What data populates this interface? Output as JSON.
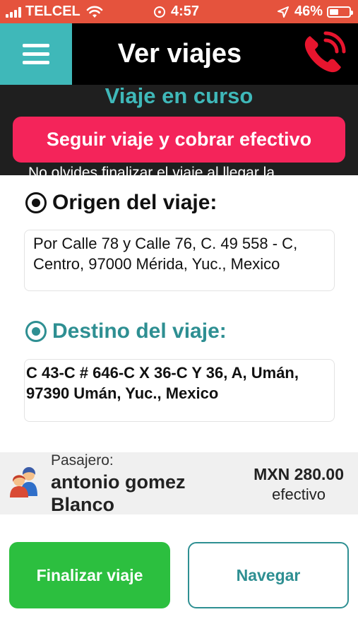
{
  "status_bar": {
    "carrier": "TELCEL",
    "time": "4:57",
    "battery_percent": "46%",
    "battery_level": 0.46,
    "background_color": "#e5533d"
  },
  "header": {
    "title": "Ver viajes",
    "menu_icon": "hamburger-menu-icon",
    "call_icon": "phone-call-icon",
    "menu_color": "#3fb8b9",
    "call_color": "#e8152e"
  },
  "trip_banner": {
    "title": "Viaje en curso",
    "follow_button_label": "Seguir viaje y cobrar efectivo",
    "note": "No olvides finalizar el viaje al llegar la",
    "button_color": "#f4245a"
  },
  "origin": {
    "label": "Origen del viaje:",
    "address": "Por Calle 78 y Calle 76, C. 49 558 - C, Centro, 97000 Mérida, Yuc., Mexico"
  },
  "destination": {
    "label": "Destino del viaje:",
    "address": "C 43-C # 646-C X 36-C Y 36, A, Umán, 97390 Umán, Yuc., Mexico"
  },
  "passenger": {
    "label": "Pasajero:",
    "name": "antonio gomez Blanco",
    "fare": "MXN 280.00",
    "payment_method": "efectivo"
  },
  "actions": {
    "finish_label": "Finalizar viaje",
    "navigate_label": "Navegar",
    "finish_color": "#2cbf3f",
    "navigate_color": "#2e8f92"
  }
}
